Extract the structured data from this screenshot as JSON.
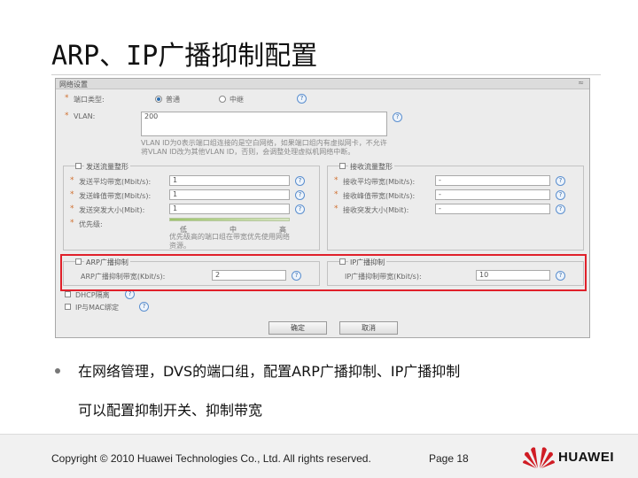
{
  "slide": {
    "title": "ARP、IP广播抑制配置"
  },
  "dialog": {
    "title": "网络设置",
    "type_label": "端口类型:",
    "type_options": [
      "普通",
      "中继"
    ],
    "vlan_label": "VLAN:",
    "vlan_value": "200",
    "vlan_note": "VLAN ID为0表示端口组连接的是空白网络，如果端口组内有虚拟网卡，不允许将VLAN ID改为其他VLAN ID，否则，会调整处理虚拟机网络中断。",
    "send_group": {
      "label": "发送流量整形",
      "rows": [
        {
          "label": "发送平均带宽(Mbit/s):",
          "value": "1"
        },
        {
          "label": "发送峰值带宽(Mbit/s):",
          "value": "1"
        },
        {
          "label": "发送突发大小(Mbit):",
          "value": "1"
        }
      ],
      "priority_label": "优先级:",
      "priority_scale": [
        "低",
        "中",
        "高"
      ],
      "priority_note": "优先级高的端口组在带宽优先使用网络资源。"
    },
    "recv_group": {
      "label": "接收流量整形",
      "rows": [
        {
          "label": "接收平均带宽(Mbit/s):",
          "value": "-"
        },
        {
          "label": "接收峰值带宽(Mbit/s):",
          "value": "-"
        },
        {
          "label": "接收突发大小(Mbit):",
          "value": "-"
        }
      ]
    },
    "arp": {
      "label": "ARP广播抑制",
      "rate_label": "ARP广播抑制带宽(Kbit/s):",
      "rate_value": "2"
    },
    "ip": {
      "label": "IP广播抑制",
      "rate_label": "IP广播抑制带宽(Kbit/s):",
      "rate_value": "10"
    },
    "dhcp_label": "DHCP隔离",
    "ipmac_label": "IP与MAC绑定",
    "ok_label": "确定",
    "cancel_label": "取消",
    "help_glyph": "?"
  },
  "body": {
    "bullet_line1": "在网络管理，DVS的端口组，配置ARP广播抑制、IP广播抑制",
    "bullet_line2": "可以配置抑制开关、抑制带宽"
  },
  "footer": {
    "copyright": "Copyright © 2010 Huawei Technologies Co., Ltd. All rights reserved.",
    "page": "Page 18",
    "brand": "HUAWEI"
  },
  "colors": {
    "highlight": "#e0202a",
    "logo": "#d01c24"
  }
}
